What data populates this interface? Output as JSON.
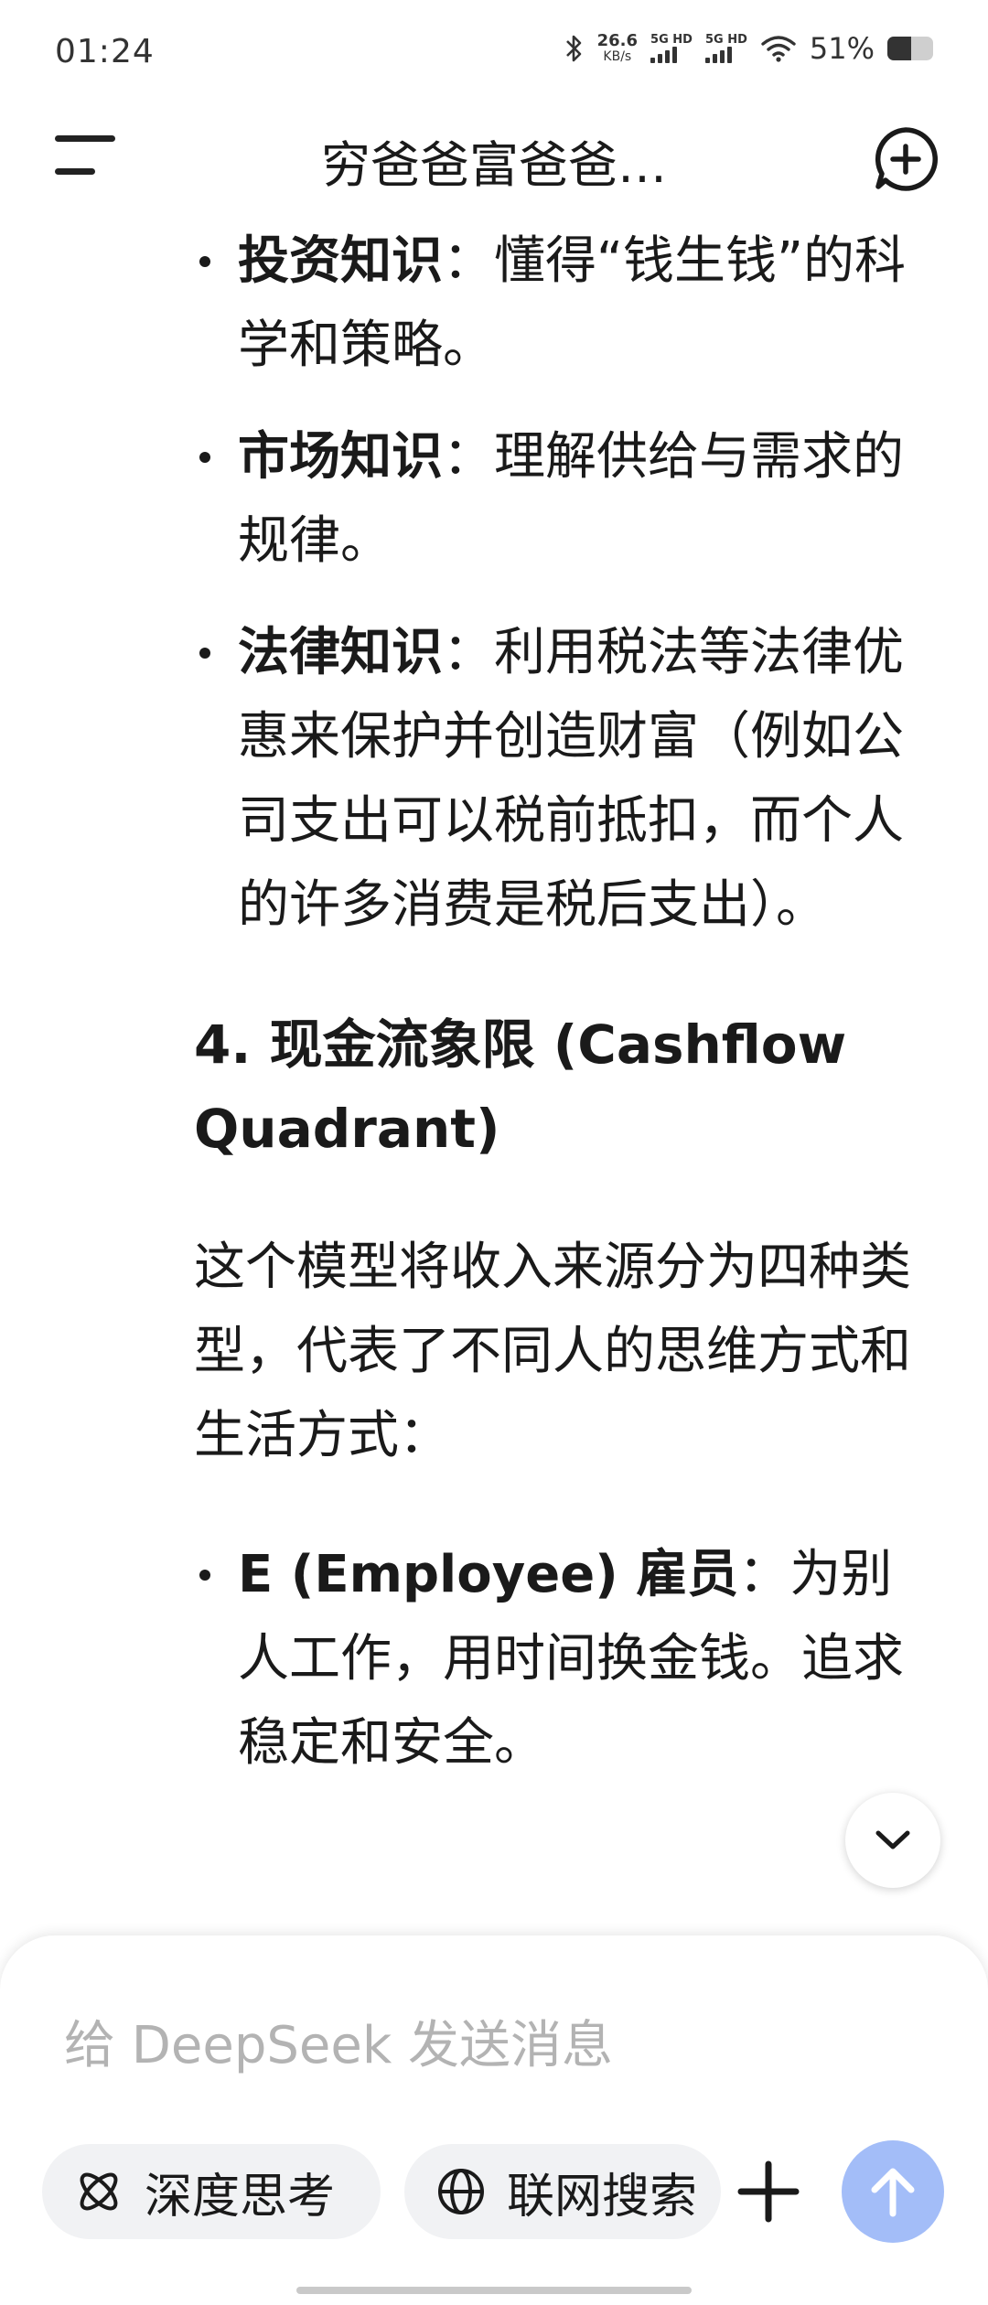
{
  "status_bar": {
    "time": "01:24",
    "net_speed_value": "26.6",
    "net_speed_unit": "KB/s",
    "sim1_label": "5G HD",
    "sim2_label": "5G HD",
    "battery_percent_text": "51%",
    "battery_level": 0.51
  },
  "header": {
    "title": "穷爸爸富爸爸…",
    "menu_icon": "menu-icon",
    "new_chat_icon": "add-chat-icon"
  },
  "content": {
    "bullets_top": [
      {
        "term": "投资知识",
        "text": "：懂得“钱生钱”的科学和策略。"
      },
      {
        "term": "市场知识",
        "text": "：理解供给与需求的规律。"
      },
      {
        "term": "法律知识",
        "text": "：利用税法等法律优惠来保护并创造财富（例如公司支出可以税前抵扣，而个人的许多消费是税后支出）。"
      }
    ],
    "section_heading": "4. 现金流象限 (Cashflow Quadrant)",
    "paragraph": "这个模型将收入来源分为四种类型，代表了不同人的思维方式和生活方式：",
    "bullets_bottom": [
      {
        "term": "E (Employee) 雇员",
        "text": "：为别人工作，用时间换金钱。追求稳定和安全。"
      }
    ]
  },
  "composer": {
    "placeholder": "给 DeepSeek 发送消息",
    "deep_think_label": "深度思考",
    "web_search_label": "联网搜索",
    "accent_color": "#a3bdf8"
  }
}
